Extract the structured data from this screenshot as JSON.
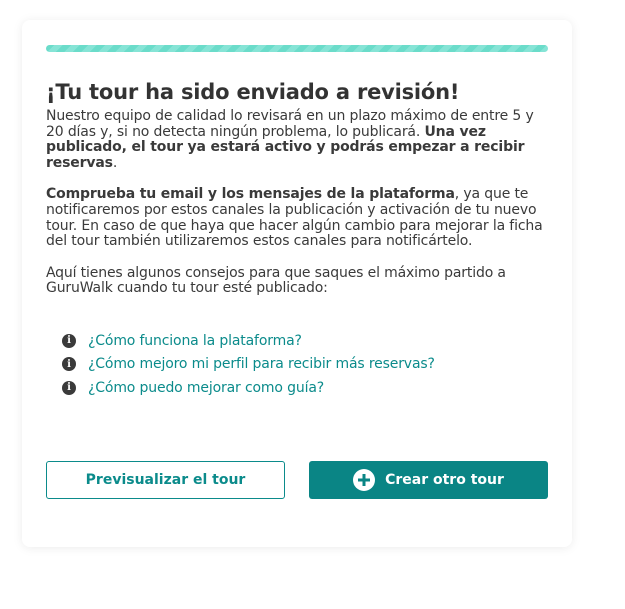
{
  "progress": {
    "percent": 100,
    "color": "#6bdcca"
  },
  "title": "¡Tu tour ha sido enviado a revisión!",
  "intro": {
    "text": "Nuestro equipo de calidad lo revisará en un plazo máximo de entre 5 y 20 días y, si no detecta ningún problema, lo publicará. ",
    "bold": "Una vez publicado, el tour ya estará activo y podrás empezar a recibir reservas",
    "end": "."
  },
  "contact": {
    "bold": "Comprueba tu email y los mensajes de la plataforma",
    "text": ", ya que te notificaremos por estos canales la publicación y activación de tu nuevo tour. En caso de que haya que hacer algún cambio para mejorar la ficha del tour también utilizaremos estos canales para notificártelo."
  },
  "tips_intro": "Aquí tienes algunos consejos para que saques el máximo partido a GuruWalk cuando tu tour esté publicado:",
  "tips": [
    {
      "icon": "info-icon",
      "label": "¿Cómo funciona la plataforma?"
    },
    {
      "icon": "info-icon",
      "label": "¿Cómo mejoro mi perfil para recibir más reservas?"
    },
    {
      "icon": "info-icon",
      "label": "¿Cómo puedo mejorar como guía?"
    }
  ],
  "buttons": {
    "preview": "Previsualizar el tour",
    "create": "Crear otro tour",
    "create_icon": "plus-circle-icon"
  },
  "colors": {
    "accent": "#0a8585",
    "link": "#0b8b8b"
  }
}
